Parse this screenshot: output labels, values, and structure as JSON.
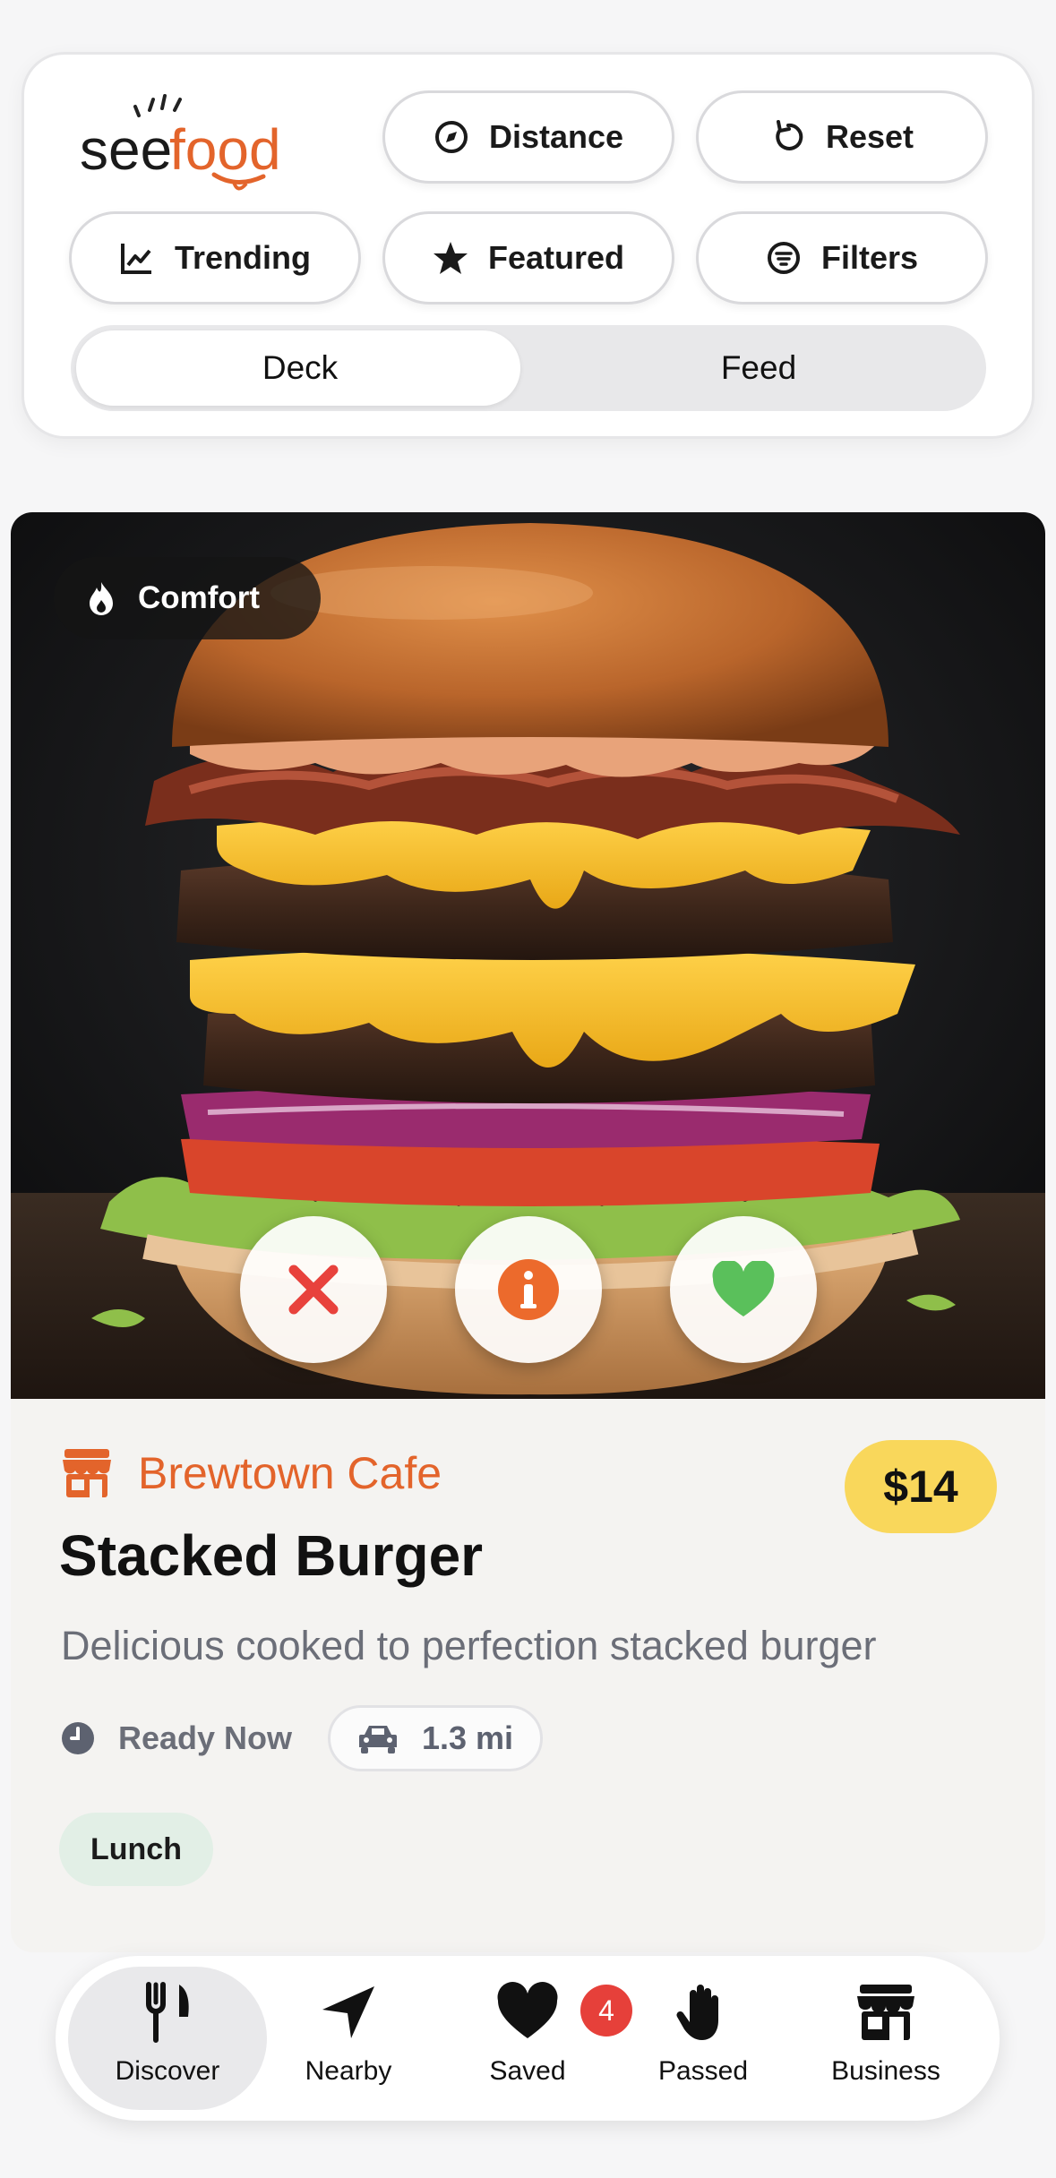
{
  "header": {
    "logo_text_see": "see",
    "logo_text_food": "food",
    "chips": {
      "distance": "Distance",
      "reset": "Reset",
      "trending": "Trending",
      "featured": "Featured",
      "filters": "Filters"
    },
    "view_toggle": {
      "deck": "Deck",
      "feed": "Feed",
      "selected": "Deck"
    }
  },
  "card": {
    "category_badge": "Comfort",
    "restaurant": "Brewtown Cafe",
    "price": "$14",
    "title": "Stacked Burger",
    "description": "Delicious cooked to perfection stacked burger",
    "ready": "Ready Now",
    "distance": "1.3 mi",
    "tag": "Lunch"
  },
  "nav": {
    "discover": "Discover",
    "nearby": "Nearby",
    "saved": "Saved",
    "saved_count": "4",
    "passed": "Passed",
    "business": "Business",
    "selected": "Discover"
  },
  "colors": {
    "accent_orange": "#e3642b",
    "price_yellow": "#f9d75b",
    "reject_red": "#e8423c",
    "like_green": "#5ac05b"
  }
}
